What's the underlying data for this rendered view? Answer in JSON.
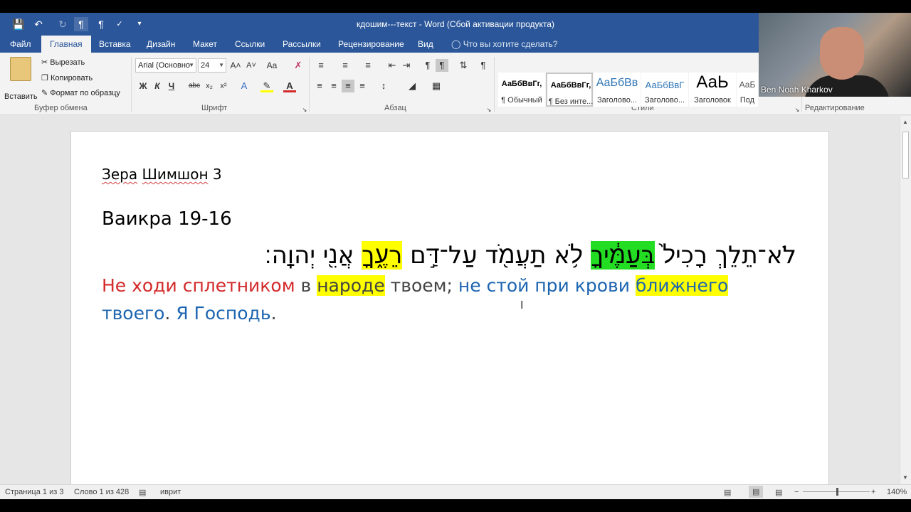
{
  "title_bar": {
    "document_title": "кдошим---текст - Word (Сбой активации продукта)",
    "quick_access": [
      "save-icon",
      "undo-icon",
      "redo-icon",
      "paragraph-rtl-icon",
      "paragraph-ltr-icon",
      "spelling-icon",
      "customize-icon"
    ]
  },
  "tabs": [
    "Файл",
    "Главная",
    "Вставка",
    "Дизайн",
    "Макет",
    "Ссылки",
    "Рассылки",
    "Рецензирование",
    "Вид"
  ],
  "tell_me": "Что вы хотите сделать?",
  "ribbon": {
    "clipboard": {
      "paste": "Вставить",
      "cut": "Вырезать",
      "copy": "Копировать",
      "format_painter": "Формат по образцу",
      "label": "Буфер обмена"
    },
    "font": {
      "font_name": "Arial (Основно",
      "font_size": "24",
      "bold": "Ж",
      "italic": "К",
      "underline": "Ч",
      "strike": "abc",
      "subscript": "x₂",
      "superscript": "x²",
      "grow": "A˄",
      "shrink": "A˅",
      "case": "Aa",
      "label": "Шрифт"
    },
    "paragraph": {
      "label": "Абзац"
    },
    "styles": {
      "label": "Стили",
      "items": [
        {
          "sample": "АаБбВвГг,",
          "name": "¶ Обычный"
        },
        {
          "sample": "АаБбВвГг,",
          "name": "¶ Без инте..."
        },
        {
          "sample": "АаБбВв",
          "name": "Заголово..."
        },
        {
          "sample": "АаБбВвГ",
          "name": "Заголово..."
        },
        {
          "sample": "АаЬ",
          "name": "Заголовок"
        },
        {
          "sample": "АаБ",
          "name": "Под"
        }
      ]
    },
    "editing": {
      "label": "Редактирование"
    }
  },
  "webcam": {
    "name": "Ben Noah Kharkov"
  },
  "document": {
    "heading_a": "Зера",
    "heading_b": "Шимшон",
    "heading_c": "3",
    "subheading": "Ваикра 19-16",
    "hebrew": {
      "p1": "לֹא־תֵלֵךְ רָכִיל֙ ",
      "p2": "בְּעַמֶּ֔יךָ",
      "p3": " לֹ֥א תַעֲמֹ֖ד עַל־דַּ֣ם ",
      "p4": "רֵעֶ֑ךָ",
      "p5": " אֲנִ֖י יְהוָֽה׃"
    },
    "russian": {
      "r1": "Не ходи сплетником",
      "r2": " в ",
      "r3": "народе",
      "r4": " твоем; ",
      "r5": "не стой при крови ",
      "r6": "ближнего",
      "r7": "твоего",
      "r8": ". ",
      "r9": "Я Господь",
      "r10": "."
    }
  },
  "status_bar": {
    "page": "Страница 1 из 3",
    "words": "Слово 1 из 428",
    "language": "иврит",
    "zoom": "140%"
  },
  "colors": {
    "word_blue": "#2b579a",
    "highlight_yellow": "#ffff00",
    "highlight_green": "#22dd22",
    "text_red": "#d32a2a",
    "text_blue": "#1d65b0"
  }
}
